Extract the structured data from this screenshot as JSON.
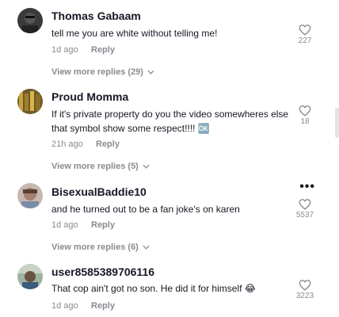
{
  "comments": [
    {
      "username": "Thomas Gabaam",
      "text": "tell me you are white without telling me!",
      "time": "1d ago",
      "reply_label": "Reply",
      "likes": "227",
      "view_more": "View more replies (29)"
    },
    {
      "username": "Proud Momma",
      "text": "If it's private property do you the video somewheres else that symbol show some respect!!!! 🆗",
      "time": "21h ago",
      "reply_label": "Reply",
      "likes": "18",
      "view_more": "View more replies (5)"
    },
    {
      "username": "BisexualBaddie10",
      "text": "and he turned out to be a fan joke's on karen",
      "time": "1d ago",
      "reply_label": "Reply",
      "likes": "5537",
      "more_options": "•••",
      "view_more": "View more replies (6)"
    },
    {
      "username": "user8585389706116",
      "text": "That cop ain't got no son. He did it for himself 😂",
      "time": "1d ago",
      "reply_label": "Reply",
      "likes": "3223"
    }
  ],
  "icons": {
    "like": "heart-outline-icon",
    "expand": "chevron-down-icon",
    "more": "more-options-icon"
  },
  "colors": {
    "text": "#161823",
    "muted": "#8a8b91",
    "background": "#ffffff"
  }
}
